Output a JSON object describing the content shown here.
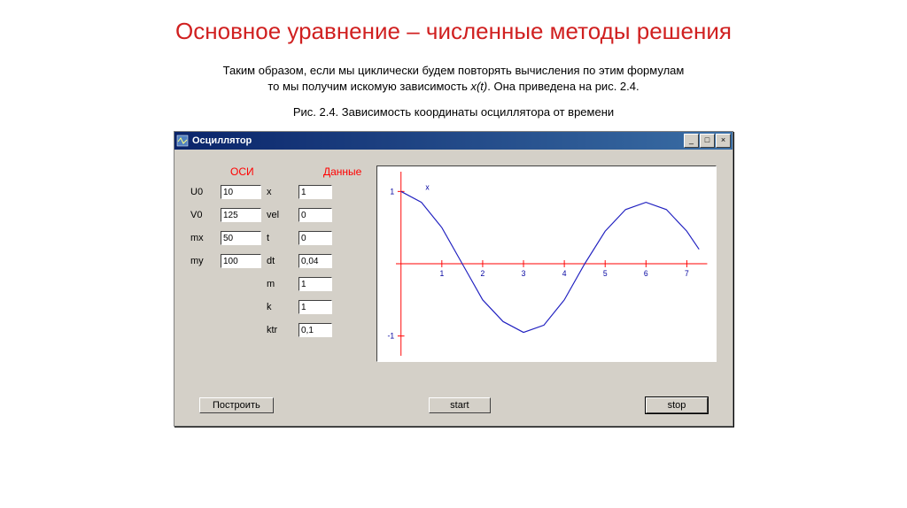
{
  "page": {
    "title": "Основное уравнение – численные методы решения",
    "description_line1": "Таким образом, если мы циклически будем повторять вычисления по этим формулам",
    "description_line2_a": "то мы получим искомую зависимость ",
    "description_line2_em": "x(t)",
    "description_line2_b": ". Она приведена на рис. 2.4.",
    "figure_caption": "Рис. 2.4. Зависимость координаты осциллятора от времени"
  },
  "window": {
    "title": "Осциллятор",
    "minimize": "_",
    "maximize": "□",
    "close": "×"
  },
  "headers": {
    "osi": "ОСИ",
    "dannye": "Данные"
  },
  "params": {
    "U0": {
      "label": "U0",
      "value": "10"
    },
    "V0": {
      "label": "V0",
      "value": "125"
    },
    "mx": {
      "label": "mx",
      "value": "50"
    },
    "my": {
      "label": "my",
      "value": "100"
    },
    "x": {
      "label": "x",
      "value": "1"
    },
    "vel": {
      "label": "vel",
      "value": "0"
    },
    "t": {
      "label": "t",
      "value": "0"
    },
    "dt": {
      "label": "dt",
      "value": "0,04"
    },
    "m": {
      "label": "m",
      "value": "1"
    },
    "k": {
      "label": "k",
      "value": "1"
    },
    "ktr": {
      "label": "ktr",
      "value": "0,1"
    }
  },
  "buttons": {
    "build": "Построить",
    "start": "start",
    "stop": "stop"
  },
  "chart_data": {
    "type": "line",
    "title": "",
    "xlabel": "",
    "ylabel": "",
    "series_label": "x",
    "x_ticks": [
      1,
      2,
      3,
      4,
      5,
      6,
      7
    ],
    "y_ticks": [
      -1,
      1
    ],
    "xlim": [
      0,
      7.5
    ],
    "ylim": [
      -1.2,
      1.2
    ],
    "x": [
      0,
      0.5,
      1,
      1.5,
      2,
      2.5,
      3,
      3.5,
      4,
      4.5,
      5,
      5.5,
      6,
      6.5,
      7,
      7.3
    ],
    "y": [
      1,
      0.85,
      0.5,
      0,
      -0.5,
      -0.8,
      -0.95,
      -0.85,
      -0.5,
      0,
      0.45,
      0.75,
      0.85,
      0.75,
      0.45,
      0.2
    ]
  }
}
